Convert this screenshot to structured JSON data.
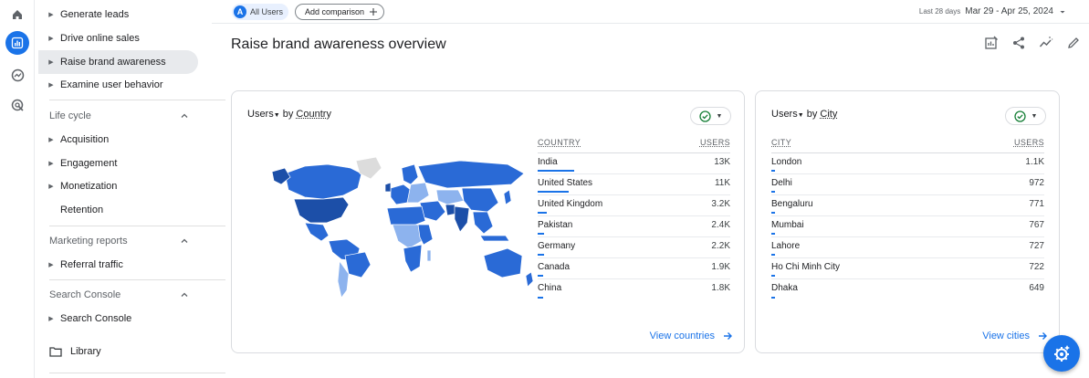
{
  "rail": {
    "icons": [
      "home-icon",
      "reports-icon",
      "explore-icon",
      "advertising-icon"
    ]
  },
  "nav": {
    "items": [
      {
        "label": "Generate leads"
      },
      {
        "label": "Drive online sales"
      },
      {
        "label": "Raise brand awareness"
      },
      {
        "label": "Examine user behavior"
      }
    ],
    "lifecycle": {
      "title": "Life cycle",
      "items": [
        {
          "label": "Acquisition"
        },
        {
          "label": "Engagement"
        },
        {
          "label": "Monetization"
        },
        {
          "label": "Retention"
        }
      ]
    },
    "marketing": {
      "title": "Marketing reports",
      "items": [
        {
          "label": "Referral traffic"
        }
      ]
    },
    "search_console": {
      "title": "Search Console",
      "items": [
        {
          "label": "Search Console"
        }
      ]
    },
    "library": {
      "label": "Library"
    }
  },
  "topbar": {
    "segment_badge": "A",
    "segment_label": "All Users",
    "add_comparison": "Add comparison",
    "range_hint": "Last 28 days",
    "date_range": "Mar 29 - Apr 25, 2024"
  },
  "page": {
    "title": "Raise brand awareness overview"
  },
  "country_card": {
    "metric": "Users",
    "by": "by",
    "dimension": "Country",
    "col_dimension": "COUNTRY",
    "col_metric": "USERS",
    "rows": [
      {
        "name": "India",
        "value": "13K",
        "share": 1.0
      },
      {
        "name": "United States",
        "value": "11K",
        "share": 0.85
      },
      {
        "name": "United Kingdom",
        "value": "3.2K",
        "share": 0.25
      },
      {
        "name": "Pakistan",
        "value": "2.4K",
        "share": 0.18
      },
      {
        "name": "Germany",
        "value": "2.2K",
        "share": 0.17
      },
      {
        "name": "Canada",
        "value": "1.9K",
        "share": 0.15
      },
      {
        "name": "China",
        "value": "1.8K",
        "share": 0.14
      }
    ],
    "view_link": "View countries"
  },
  "city_card": {
    "metric": "Users",
    "by": "by",
    "dimension": "City",
    "col_dimension": "CITY",
    "col_metric": "USERS",
    "rows": [
      {
        "name": "London",
        "value": "1.1K",
        "share": 0.1
      },
      {
        "name": "Delhi",
        "value": "972",
        "share": 0.09
      },
      {
        "name": "Bengaluru",
        "value": "771",
        "share": 0.07
      },
      {
        "name": "Mumbai",
        "value": "767",
        "share": 0.07
      },
      {
        "name": "Lahore",
        "value": "727",
        "share": 0.065
      },
      {
        "name": "Ho Chi Minh City",
        "value": "722",
        "share": 0.065
      },
      {
        "name": "Dhaka",
        "value": "649",
        "share": 0.06
      }
    ],
    "view_link": "View cities"
  },
  "colors": {
    "accent": "#1a73e8",
    "map_dark": "#1c4fa8",
    "map_mid": "#2a6ad6",
    "map_light": "#8db3ee",
    "map_none": "#dcdcdc"
  }
}
